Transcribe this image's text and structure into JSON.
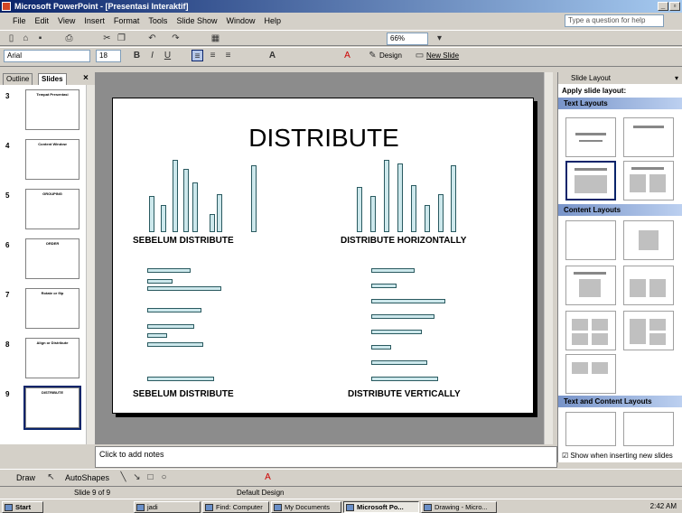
{
  "window": {
    "title": "Microsoft PowerPoint - [Presentasi Interaktif]"
  },
  "menu": {
    "items": [
      "File",
      "Edit",
      "View",
      "Insert",
      "Format",
      "Tools",
      "Slide Show",
      "Window",
      "Help"
    ],
    "ask_placeholder": "Type a question for help"
  },
  "standard_toolbar": {
    "zoom": "66%"
  },
  "formatting_toolbar": {
    "font": "Arial",
    "size": "18",
    "design": "Design",
    "new_slide": "New Slide"
  },
  "left_panel": {
    "tabs": [
      "Outline",
      "Slides"
    ],
    "slides": [
      {
        "num": "3",
        "title": "Tempat Presentasi"
      },
      {
        "num": "4",
        "title": "Content Window"
      },
      {
        "num": "5",
        "title": "GROUPING"
      },
      {
        "num": "6",
        "title": "ORDER"
      },
      {
        "num": "7",
        "title": "Rotate or flip"
      },
      {
        "num": "8",
        "title": "Align or Distribute"
      },
      {
        "num": "9",
        "title": "DISTRIBUTE"
      }
    ]
  },
  "slide": {
    "title": "DISTRIBUTE",
    "captions": [
      "SEBELUM DISTRIBUTE",
      "DISTRIBUTE HORIZONTALLY",
      "SEBELUM DISTRIBUTE",
      "DISTRIBUTE VERTICALLY"
    ]
  },
  "notes": {
    "placeholder": "Click to add notes"
  },
  "task_pane": {
    "title": "Slide Layout",
    "apply": "Apply slide layout:",
    "sections": [
      "Text Layouts",
      "Content Layouts",
      "Text and Content Layouts"
    ],
    "checkbox": "Show when inserting new slides"
  },
  "drawing_toolbar": {
    "draw": "Draw",
    "autoshapes": "AutoShapes"
  },
  "status": {
    "slide": "Slide 9 of 9",
    "design": "Default Design"
  },
  "taskbar": {
    "start": "Start",
    "tasks": [
      "jadi",
      "Find: Computer",
      "My Documents",
      "Microsoft Po...",
      "Drawing - Micro..."
    ],
    "time": "2:42 AM"
  },
  "colors": {
    "title_bar": "#0a246a",
    "bar_fill": "#cde8ec",
    "section_header": "#7894c9"
  }
}
